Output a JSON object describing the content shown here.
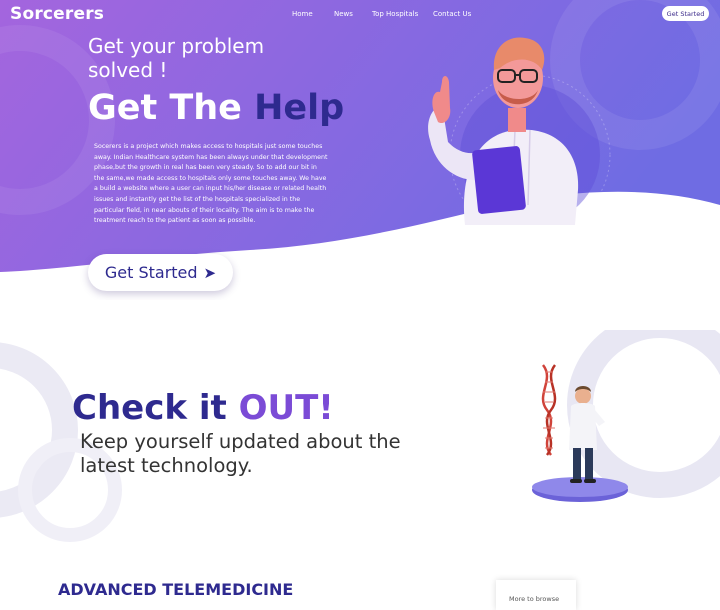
{
  "brand": {
    "name": "Sorcerers"
  },
  "nav": {
    "links": [
      "Home",
      "News",
      "Top Hospitals",
      "Contact Us"
    ],
    "cta": "Get Started"
  },
  "hero": {
    "subtitle": "Get your problem solved !",
    "title_prefix": "Get The ",
    "title_accent": "Help",
    "description": "Socerers is a project which makes access to hospitals just some touches away. Indian Healthcare system has been always under that development phase,but the growth in real has been very steady. So to add our bit in the same,we made access to hospitals only some touches away. We have a build a website where a user can input his/her disease or related health issues and instantly get the list of the hospitals specialized in the particular field, in near abouts of their locality. The aim is to make the treatment reach to the patient as soon as possible.",
    "button_label": "Get Started",
    "button_arrow": "➤"
  },
  "check": {
    "title_prefix": "Check it ",
    "title_accent": "OUT!",
    "subtitle": "Keep yourself updated about the latest technology."
  },
  "section": {
    "title": "ADVANCED TELEMEDICINE",
    "card_text": "More to browse"
  },
  "colors": {
    "gradient_start": "#a465de",
    "gradient_end": "#6f6ce3",
    "brand_dark": "#2e2a8f",
    "accent_purple": "#7b4bd6"
  }
}
